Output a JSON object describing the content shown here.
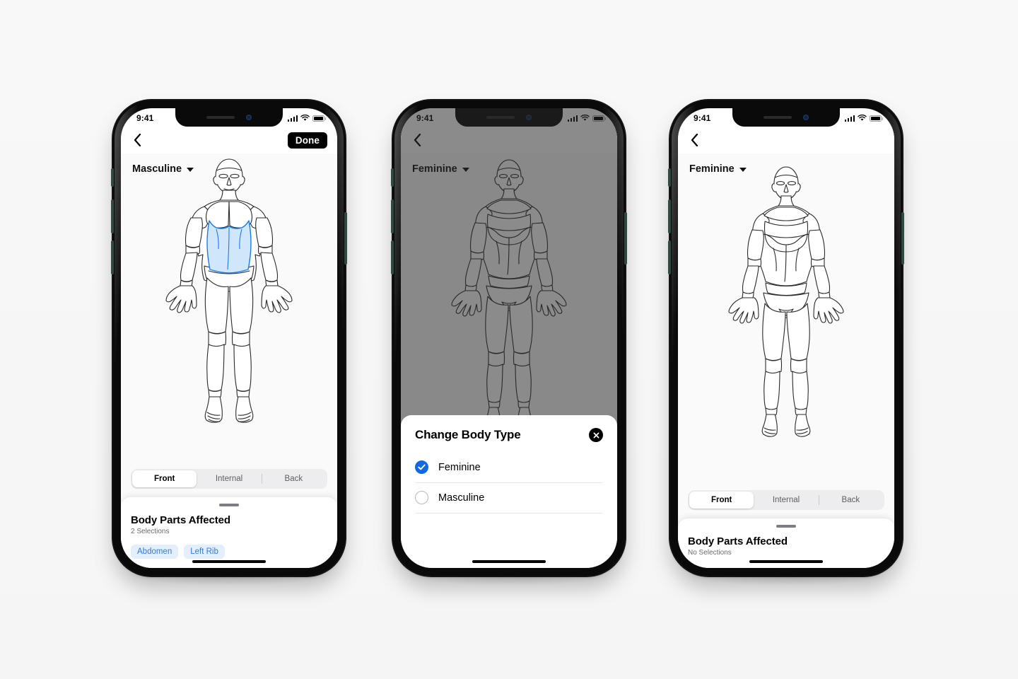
{
  "statusbar": {
    "time": "9:41",
    "signal_icon": "cellular-signal-icon",
    "wifi_icon": "wifi-icon",
    "battery_icon": "battery-icon"
  },
  "colors": {
    "accent_blue": "#2f7ae5",
    "chip_bg": "#e3effd",
    "highlight_fill": "#cfe6fb",
    "highlight_stroke": "#1a7ceb",
    "radio_checked": "#1268e0",
    "segment_bg": "#ededf0",
    "dim_overlay": "#7b7b7b"
  },
  "screens": [
    {
      "id": "masculine-selected",
      "navbar": {
        "back_label": "Back",
        "done_label": "Done",
        "show_done": true
      },
      "gender": {
        "value": "Masculine",
        "caret_icon": "chevron-down-icon"
      },
      "figure": "masculine-front",
      "highlight": "abdomen-and-left-rib",
      "segmented": {
        "options": [
          "Front",
          "Internal",
          "Back"
        ],
        "selected": "Front"
      },
      "sheet": {
        "title": "Body Parts Affected",
        "subtitle": "2 Selections",
        "chips": [
          "Abdomen",
          "Left Rib"
        ]
      }
    },
    {
      "id": "change-body-type-modal",
      "navbar": {
        "back_label": "Back",
        "done_label": "Done",
        "show_done": false
      },
      "gender": {
        "value": "Feminine",
        "caret_icon": "chevron-down-icon"
      },
      "figure": "feminine-front",
      "dimmed": true,
      "modal": {
        "title": "Change Body Type",
        "close_icon": "close-icon",
        "options": [
          {
            "label": "Feminine",
            "checked": true
          },
          {
            "label": "Masculine",
            "checked": false
          }
        ]
      }
    },
    {
      "id": "feminine-empty",
      "navbar": {
        "back_label": "Back",
        "done_label": "Done",
        "show_done": false
      },
      "gender": {
        "value": "Feminine",
        "caret_icon": "chevron-down-icon"
      },
      "figure": "feminine-front",
      "segmented": {
        "options": [
          "Front",
          "Internal",
          "Back"
        ],
        "selected": "Front"
      },
      "sheet": {
        "title": "Body Parts Affected",
        "subtitle": "No Selections",
        "chips": []
      }
    }
  ]
}
